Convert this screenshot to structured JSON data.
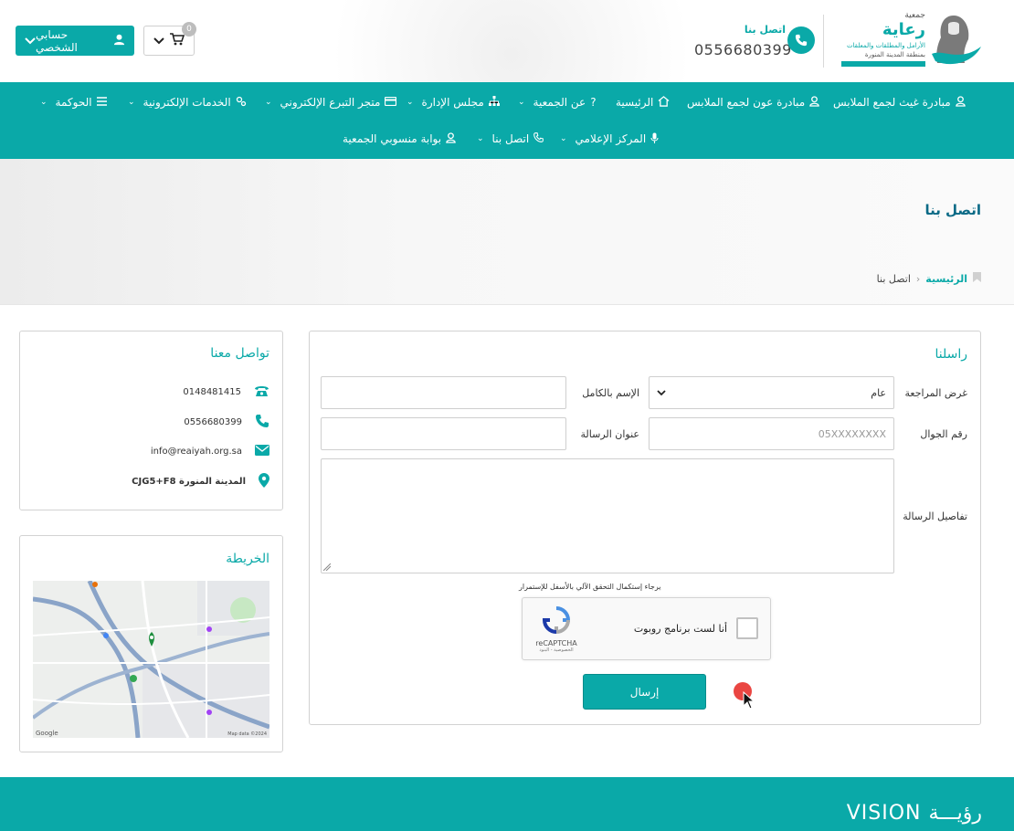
{
  "header": {
    "account_label": "حسابي الشخصي",
    "cart_count": "0",
    "contact_label": "اتصل بنا",
    "contact_phone": "0556680399",
    "logo": {
      "top": "جمعية",
      "main": "رعاية",
      "sub1": "الأرامل والمطلقات والمعلقات",
      "sub2": "بمنطقة المدينة المنورة"
    }
  },
  "nav": {
    "row1": [
      {
        "label": "مبادرة غيث لجمع الملابس",
        "icon": "user-icon"
      },
      {
        "label": "مبادرة عون لجمع الملابس",
        "icon": "user-icon"
      },
      {
        "label": "الرئيسية",
        "icon": "home-icon"
      },
      {
        "label": "عن الجمعية",
        "icon": "question-icon"
      },
      {
        "label": "مجلس الإدارة",
        "icon": "sitemap-icon"
      },
      {
        "label": "متجر التبرع الإلكتروني",
        "icon": "card-icon"
      },
      {
        "label": "الخدمات الإلكترونية",
        "icon": "gears-icon"
      },
      {
        "label": "الحوكمة",
        "icon": "list-icon"
      }
    ],
    "row2": [
      {
        "label": "المركز الإعلامي",
        "icon": "mic-icon"
      },
      {
        "label": "اتصل بنا",
        "icon": "phone-icon"
      },
      {
        "label": "بوابة منسوبي الجمعية",
        "icon": "user-icon"
      }
    ]
  },
  "page": {
    "title": "اتصل بنا",
    "breadcrumb_home": "الرئيسية",
    "breadcrumb_current": "اتصل بنا"
  },
  "contact_card": {
    "title": "تواصل معنا",
    "landline": "0148481415",
    "mobile": "0556680399",
    "email": "info@reaiyah.org.sa",
    "address": "CJG5+F8 المدينة المنورة"
  },
  "map_card": {
    "title": "الخريطة",
    "attribution": "Map data ©2024"
  },
  "form": {
    "title": "راسلنا",
    "purpose_label": "غرض المراجعة",
    "purpose_value": "عام",
    "name_label": "الإسم بالكامل",
    "name_value": "",
    "mobile_label": "رقم الجوال",
    "mobile_placeholder": "05XXXXXXXX",
    "subject_label": "عنوان الرسالة",
    "subject_value": "",
    "details_label": "تفاصيل الرسالة",
    "captcha_note": "يرجاء إستكمال التحقق الآلي بالأسفل للإستمرار",
    "captcha_text": "أنا لست برنامج روبوت",
    "captcha_brand": "reCAPTCHA",
    "captcha_links": "الخصوصية - البنود",
    "submit_label": "إرسال"
  },
  "footer": {
    "vision_text": "VISION رؤيـــة"
  },
  "colors": {
    "primary": "#0aa9a8",
    "title_blue": "#0b6a86",
    "cursor_red": "#e8322e"
  }
}
